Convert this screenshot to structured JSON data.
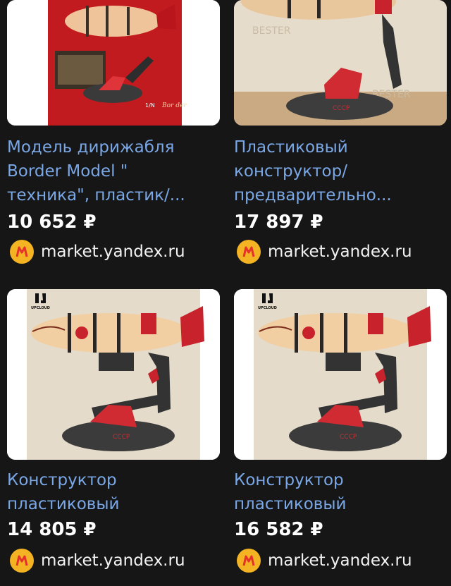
{
  "products": [
    {
      "title_lines": [
        "Модель дирижабля",
        "Border Model \"",
        "техника\", пластик/..."
      ],
      "price": "10 652 ₽",
      "source": "market.yandex.ru",
      "image_labels": [
        "1/N",
        "Bor der"
      ]
    },
    {
      "title_lines": [
        "Пластиковый",
        "конструктор/",
        "предварительно..."
      ],
      "price": "17 897 ₽",
      "source": "market.yandex.ru",
      "image_labels": [
        "BESTER",
        "BESTER"
      ]
    },
    {
      "title_lines": [
        "Конструктор",
        "пластиковый"
      ],
      "price": "14 805 ₽",
      "source": "market.yandex.ru",
      "image_labels": [
        "UPCLOUD",
        "CCCP"
      ]
    },
    {
      "title_lines": [
        "Конструктор",
        "пластиковый"
      ],
      "price": "16 582 ₽",
      "source": "market.yandex.ru",
      "image_labels": [
        "UPCLOUD",
        "CCCP"
      ]
    }
  ],
  "colors": {
    "link": "#7aa7e6",
    "bg": "#161616",
    "accent_red": "#c8232c",
    "logo_yellow": "#f4b323"
  }
}
